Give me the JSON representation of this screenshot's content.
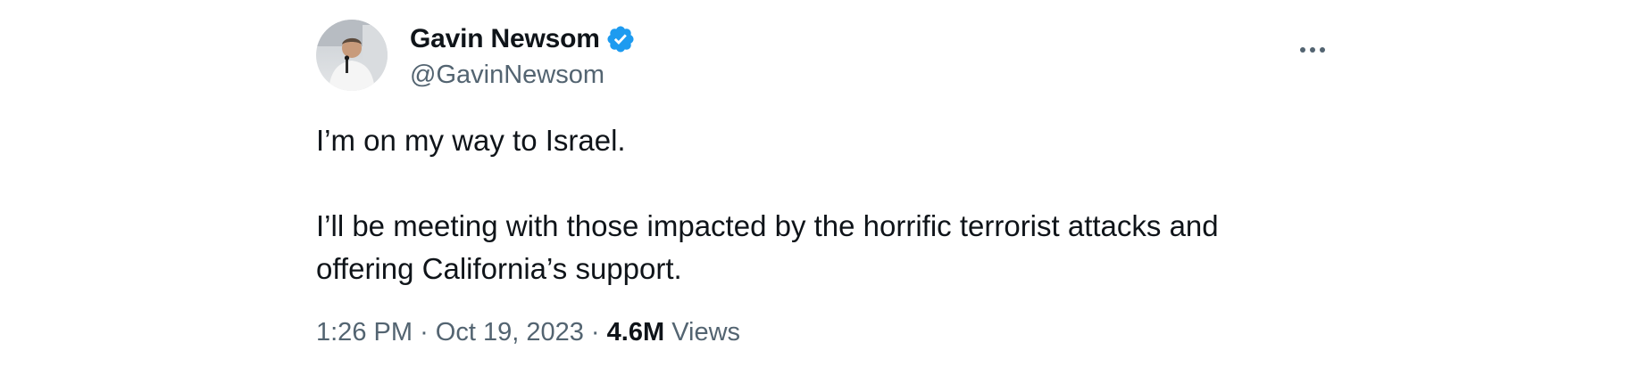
{
  "author": {
    "display_name": "Gavin Newsom",
    "handle": "@GavinNewsom",
    "verified": true,
    "verified_color": "#1d9bf0"
  },
  "tweet": {
    "paragraphs": [
      "I’m on my way to Israel.",
      "I’ll be meeting with those impacted by the horrific terrorist attacks and",
      "offering California’s support."
    ],
    "time": "1:26 PM",
    "date": "Oct 19, 2023",
    "separator": "·",
    "views_count": "4.6M",
    "views_label": "Views"
  },
  "icons": {
    "more": "more-horizontal-icon",
    "verified": "verified-badge-icon"
  }
}
